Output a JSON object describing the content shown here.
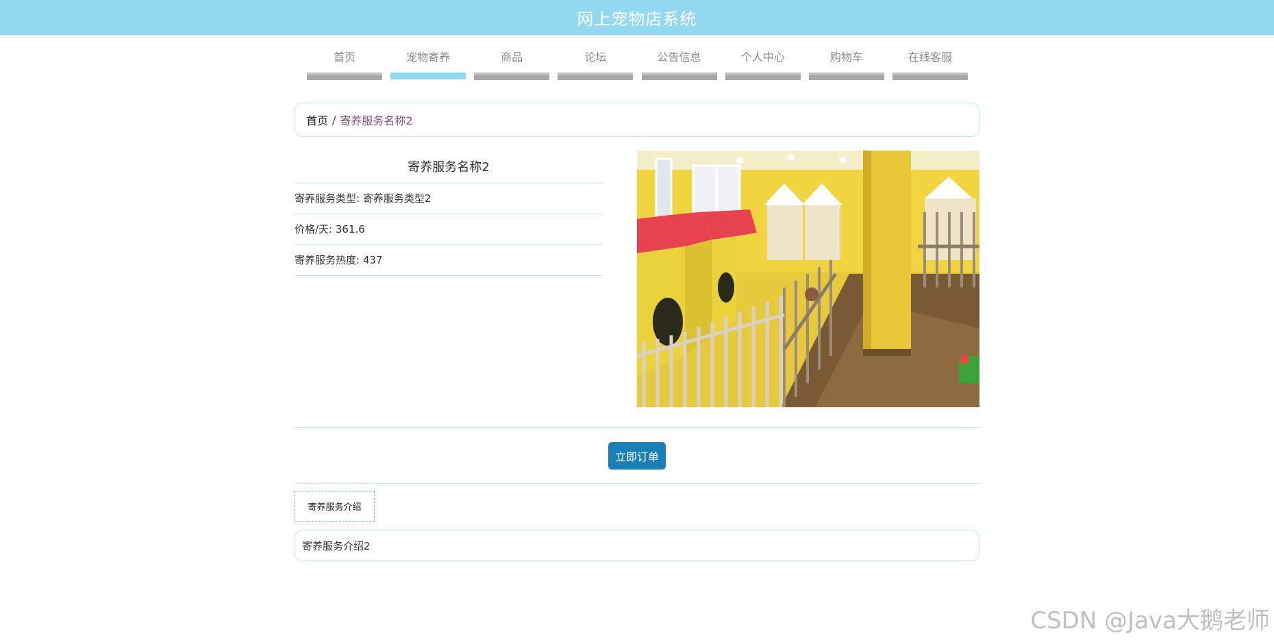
{
  "header": {
    "title": "网上宠物店系统",
    "banner_color": "#93d8f1"
  },
  "nav": {
    "items": [
      {
        "label": "首页",
        "active": false
      },
      {
        "label": "宠物寄养",
        "active": true
      },
      {
        "label": "商品",
        "active": false
      },
      {
        "label": "论坛",
        "active": false
      },
      {
        "label": "公告信息",
        "active": false
      },
      {
        "label": "个人中心",
        "active": false
      },
      {
        "label": "购物车",
        "active": false
      },
      {
        "label": "在线客服",
        "active": false
      }
    ]
  },
  "breadcrumb": {
    "home": "首页",
    "separator": "/",
    "current": "寄养服务名称2"
  },
  "detail": {
    "title": "寄养服务名称2",
    "rows": [
      "寄养服务类型: 寄养服务类型2",
      "价格/天: 361.6",
      "寄养服务热度: 437"
    ]
  },
  "actions": {
    "order_label": "立即订单",
    "button_color": "#1a7fb5"
  },
  "tabs": {
    "intro_label": "寄养服务介绍"
  },
  "intro": {
    "text": "寄养服务介绍2"
  },
  "watermark": {
    "text": "CSDN @Java大鹅老师"
  }
}
